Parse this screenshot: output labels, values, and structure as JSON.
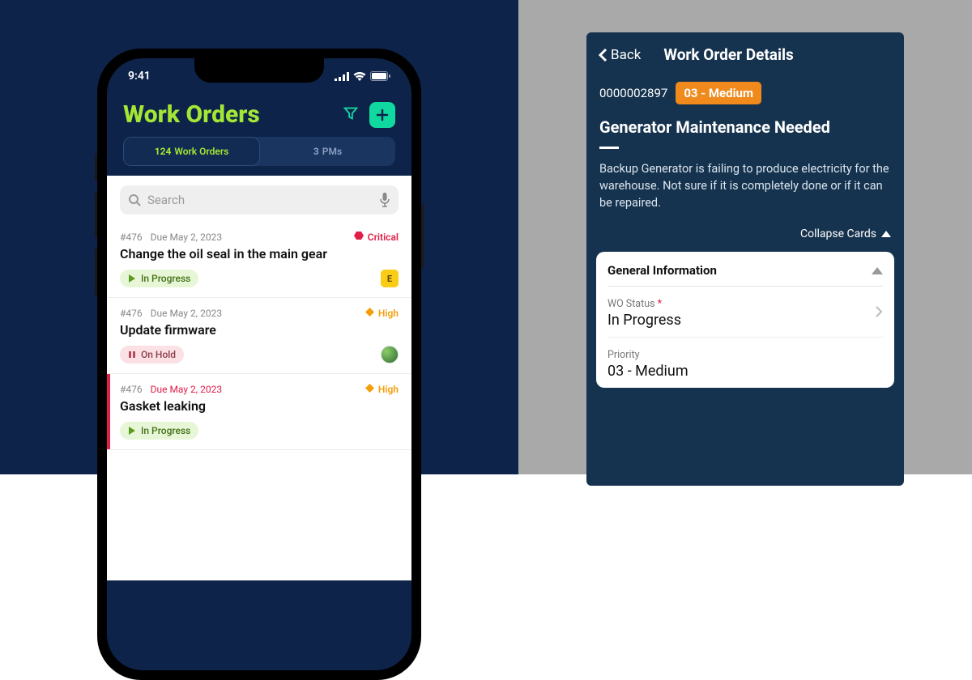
{
  "statusbar": {
    "time": "9:41"
  },
  "header": {
    "title": "Work Orders"
  },
  "tabs": {
    "workorders": {
      "count": "124",
      "label": "Work Orders"
    },
    "pms": {
      "count": "3",
      "label": "PMs"
    }
  },
  "search": {
    "placeholder": "Search"
  },
  "workorders": [
    {
      "id": "#476",
      "due": "Due May 2, 2023",
      "overdue": false,
      "priority": {
        "label": "Critical",
        "level": "critical"
      },
      "title": "Change the oil seal in the main gear",
      "status": {
        "label": "In Progress",
        "kind": "inprog"
      },
      "assignee": {
        "type": "badge",
        "initial": "E"
      },
      "redbar": false
    },
    {
      "id": "#476",
      "due": "Due May 2, 2023",
      "overdue": false,
      "priority": {
        "label": "High",
        "level": "high"
      },
      "title": "Update firmware",
      "status": {
        "label": "On Hold",
        "kind": "onhold"
      },
      "assignee": {
        "type": "avatar"
      },
      "redbar": false
    },
    {
      "id": "#476",
      "due": "Due May 2, 2023",
      "overdue": true,
      "priority": {
        "label": "High",
        "level": "high"
      },
      "title": "Gasket leaking",
      "status": {
        "label": "In Progress",
        "kind": "inprog"
      },
      "assignee": {
        "type": "none"
      },
      "redbar": true
    }
  ],
  "detail": {
    "back": "Back",
    "title": "Work Order Details",
    "id": "0000002897",
    "priorityBadge": "03 - Medium",
    "subject": "Generator Maintenance Needed",
    "description": "Backup Generator is failing to produce electricity for the warehouse. Not sure if it is completely done or if it can be repaired.",
    "collapse": "Collapse Cards",
    "card": {
      "title": "General Information",
      "fields": {
        "status": {
          "label": "WO Status",
          "required": true,
          "value": "In Progress"
        },
        "priority": {
          "label": "Priority",
          "required": false,
          "value": "03 - Medium"
        }
      }
    }
  }
}
